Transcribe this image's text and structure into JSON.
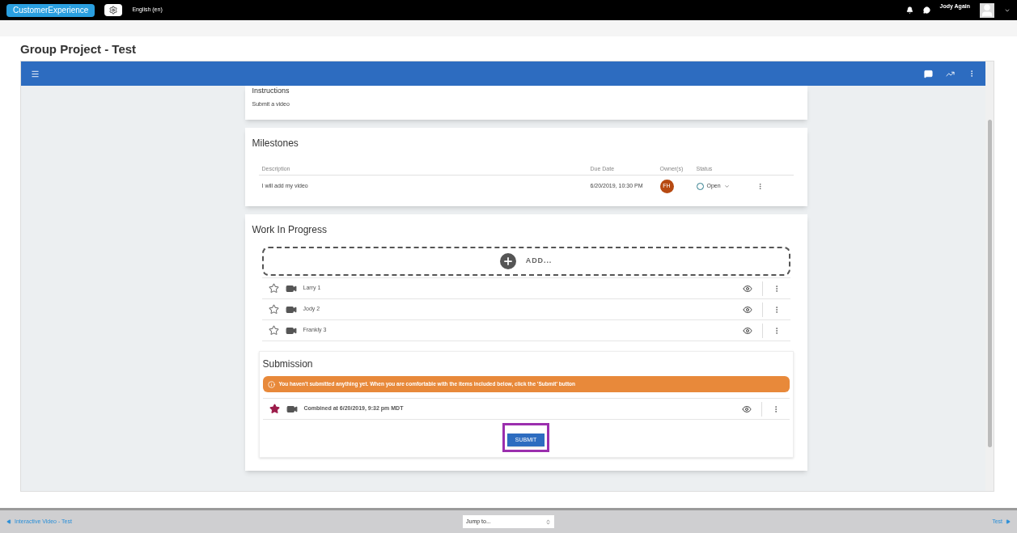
{
  "topbar": {
    "brand": "CustomerExperience",
    "language": "English (en)",
    "user": "Jody Again"
  },
  "page_title": "Group Project - Test",
  "instructions": {
    "title": "Instructions",
    "text": "Submit a video"
  },
  "milestones": {
    "title": "Milestones",
    "columns": [
      "Description",
      "Due Date",
      "Owner(s)",
      "Status"
    ],
    "rows": [
      {
        "description": "I will add my video",
        "due": "6/20/2019, 10:30 PM",
        "owner": "FH",
        "status": "Open"
      }
    ]
  },
  "work_in_progress": {
    "title": "Work In Progress",
    "add_label": "ADD...",
    "items": [
      {
        "name": "Larry 1",
        "starred": false
      },
      {
        "name": "Jody 2",
        "starred": false
      },
      {
        "name": "Frankly 3",
        "starred": false
      }
    ]
  },
  "submission": {
    "title": "Submission",
    "alert": "You haven't submitted anything yet. When you are comfortable with the items included below, click the 'Submit' button",
    "items": [
      {
        "name": "Combined at 6/20/2019, 9:32 pm MDT",
        "starred": true
      }
    ],
    "button": "SUBMIT",
    "button_highlighted": true
  },
  "footer": {
    "prev": "Interactive Video - Test",
    "jump": "Jump to...",
    "next": "Test"
  }
}
